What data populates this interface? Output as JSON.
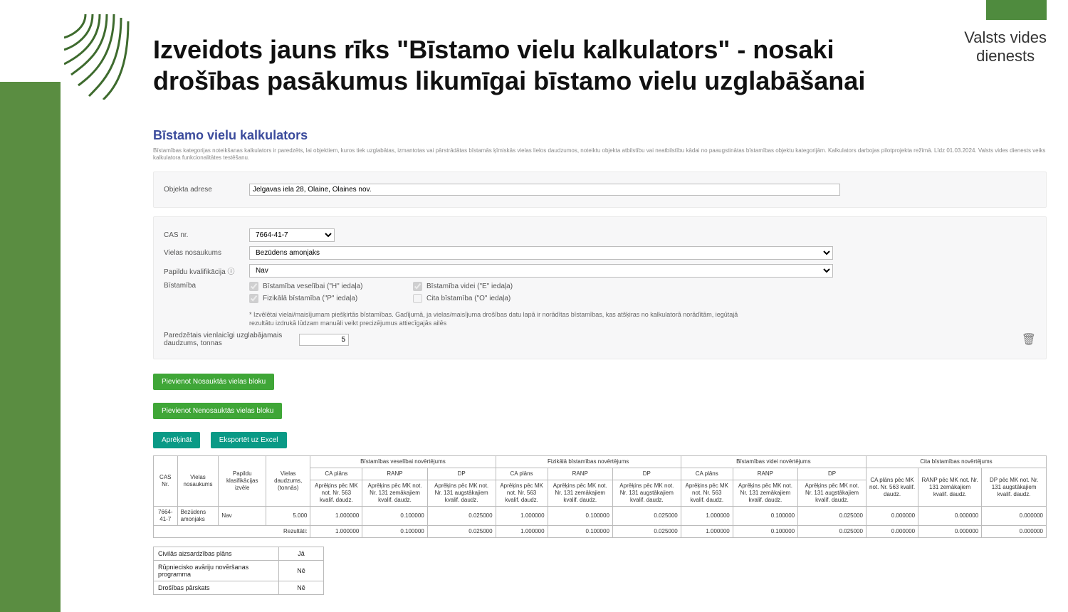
{
  "brand": {
    "line1": "Valsts vides",
    "line2": "dienests"
  },
  "headline": "Izveidots jauns rīks \"Bīstamo vielu kalkulators\" - nosaki drošības pasākumus likumīgai bīstamo vielu uzglabāšanai",
  "calc": {
    "title": "Bīstamo vielu kalkulators",
    "subtitle": "Bīstamības kategorijas noteikšanas kalkulators ir paredzēts, lai objektiem, kuros tiek uzglabātas, izmantotas vai pārstrādātas bīstamās ķīmiskās vielas lielos daudzumos, noteiktu objekta atbilstību vai neatbilstību kādai no paaugstinātas bīstamības objektu kategorijām. Kalkulators darbojas pilotprojekta režīmā. Līdz 01.03.2024. Valsts vides dienests veiks kalkulatora funkcionalitātes testēšanu.",
    "address_label": "Objekta adrese",
    "address_value": "Jelgavas iela 28, Olaine, Olaines nov.",
    "cas_label": "CAS nr.",
    "cas_value": "7664-41-7",
    "name_label": "Vielas nosaukums",
    "name_value": "Bezūdens amonjaks",
    "qual_label": "Papildu kvalifikācija",
    "qual_value": "Nav",
    "hazard_label": "Bīstamība",
    "hazards": {
      "h": {
        "label": "Bīstamība veselībai (\"H\" iedaļa)",
        "checked": true
      },
      "p": {
        "label": "Fizikālā bīstamība (\"P\" iedaļa)",
        "checked": true
      },
      "e": {
        "label": "Bīstamība videi (\"E\" iedaļa)",
        "checked": true
      },
      "o": {
        "label": "Cita bīstamība (\"O\" iedaļa)",
        "checked": false
      }
    },
    "hazard_note": "* Izvēlētai vielai/maisījumam piešķirtās bīstamības. Gadījumā, ja vielas/maisījuma drošības datu lapā ir norādītas bīstamības, kas atšķiras no kalkulatorā norādītām, iegūtajā rezultātu izdrukā lūdzam manuāli veikt precizējumus attiecīgajās ailēs",
    "qty_label": "Paredzētais vienlaicīgi uzglabājamais daudzums, tonnas",
    "qty_value": "5",
    "buttons": {
      "add_named": "Pievienot Nosauktās vielas bloku",
      "add_unnamed": "Pievienot Nenosauktās vielas bloku",
      "calculate": "Aprēķināt",
      "export": "Eksportēt uz Excel"
    }
  },
  "table": {
    "head": {
      "cas": "CAS Nr.",
      "name": "Vielas nosaukums",
      "qual": "Papildu klasifikācijas izvēle",
      "qty": "Vielas daudzums, (tonnās)",
      "g_h": "Bīstamības veselībai novērtējums",
      "g_p": "Fizikālā bīstamības novērtējums",
      "g_e": "Bīstamības videi novērtējums",
      "g_o": "Cita bīstamības novērtējums",
      "sub_ca": "CA plāns",
      "sub_ranp": "RANP",
      "sub_dp": "DP",
      "o_ca": "CA plāns pēc MK not. Nr. 563 kvalif. daudz.",
      "o_ranp": "RANP pēc MK not. Nr. 131 zemākajiem kvalif. daudz.",
      "o_dp": "DP pēc MK not. Nr. 131 augstākajiem kvalif. daudz.",
      "third_563": "Aprēķins pēc MK not. Nr. 563 kvalif. daudz.",
      "third_131low": "Aprēķins pēc MK not. Nr. 131 zemākajiem kvalif. daudz.",
      "third_131high": "Aprēķins pēc MK not. Nr. 131 augstākajiem kvalif. daudz."
    },
    "row": {
      "cas": "7664-41-7",
      "name": "Bezūdens amonjaks",
      "qual": "Nav",
      "qty": "5.000",
      "h": [
        "1.000000",
        "0.100000",
        "0.025000"
      ],
      "p": [
        "1.000000",
        "0.100000",
        "0.025000"
      ],
      "e": [
        "1.000000",
        "0.100000",
        "0.025000"
      ],
      "o": [
        "0.000000",
        "0.000000",
        "0.000000"
      ]
    },
    "totals_label": "Rezultāti:",
    "totals": {
      "h": [
        "1.000000",
        "0.100000",
        "0.025000"
      ],
      "p": [
        "1.000000",
        "0.100000",
        "0.025000"
      ],
      "e": [
        "1.000000",
        "0.100000",
        "0.025000"
      ],
      "o": [
        "0.000000",
        "0.000000",
        "0.000000"
      ]
    }
  },
  "summary": [
    {
      "label": "Civilās aizsardzības plāns",
      "value": "Jā"
    },
    {
      "label": "Rūpniecisko avāriju novēršanas programma",
      "value": "Nē"
    },
    {
      "label": "Drošības pārskats",
      "value": "Nē"
    }
  ]
}
